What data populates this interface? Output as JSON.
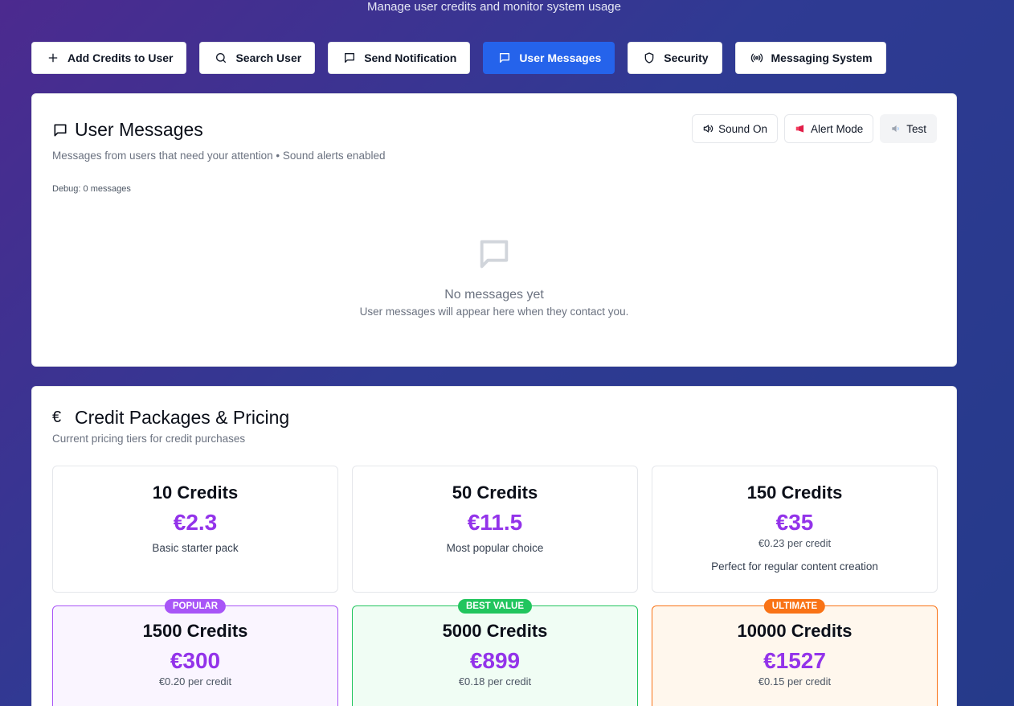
{
  "header": {
    "subtitle": "Manage user credits and monitor system usage"
  },
  "toolbar": {
    "buttons": [
      {
        "label": "Add Credits to User",
        "icon": "plus-icon",
        "active": false
      },
      {
        "label": "Search User",
        "icon": "search-icon",
        "active": false
      },
      {
        "label": "Send Notification",
        "icon": "message-square-icon",
        "active": false
      },
      {
        "label": "User Messages",
        "icon": "message-square-icon",
        "active": true
      },
      {
        "label": "Security",
        "icon": "shield-icon",
        "active": false
      },
      {
        "label": "Messaging System",
        "icon": "radio-icon",
        "active": false
      }
    ]
  },
  "messages": {
    "title": "User Messages",
    "description": "Messages from users that need your attention • Sound alerts enabled",
    "debug": "Debug: 0 messages",
    "controls": {
      "sound": "Sound On",
      "alert": "Alert Mode",
      "test": "Test"
    },
    "empty": {
      "title": "No messages yet",
      "subtitle": "User messages will appear here when they contact you."
    }
  },
  "pricing": {
    "title": "Credit Packages & Pricing",
    "description": "Current pricing tiers for credit purchases",
    "packages": [
      {
        "name": "10 Credits",
        "price": "€2.3",
        "per": "",
        "desc": "Basic starter pack",
        "badge": ""
      },
      {
        "name": "50 Credits",
        "price": "€11.5",
        "per": "",
        "desc": "Most popular choice",
        "badge": ""
      },
      {
        "name": "150 Credits",
        "price": "€35",
        "per": "€0.23 per credit",
        "desc": "Perfect for regular content creation",
        "badge": ""
      },
      {
        "name": "1500 Credits",
        "price": "€300",
        "per": "€0.20 per credit",
        "desc": "",
        "badge": "POPULAR"
      },
      {
        "name": "5000 Credits",
        "price": "€899",
        "per": "€0.18 per credit",
        "desc": "",
        "badge": "BEST VALUE"
      },
      {
        "name": "10000 Credits",
        "price": "€1527",
        "per": "€0.15 per credit",
        "desc": "",
        "badge": "ULTIMATE"
      }
    ]
  },
  "colors": {
    "primary": "#2563eb",
    "price": "#9333ea",
    "popular": "#a855f7",
    "best_value": "#22c55e",
    "ultimate": "#f97316"
  }
}
